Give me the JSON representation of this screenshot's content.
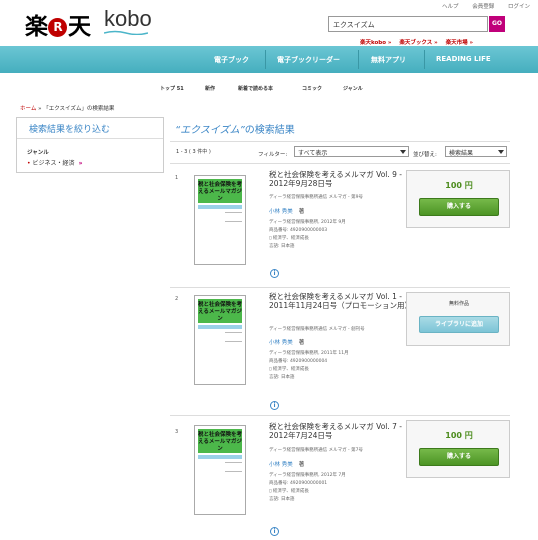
{
  "header": {
    "top_links": [
      "ヘルプ",
      "会員登録",
      "ログイン"
    ],
    "logo_left": "楽",
    "logo_r": "R",
    "logo_right": "天",
    "logo_kobo": "kobo",
    "search_value": "エクスイズム",
    "search_button": "GO",
    "sub_links": [
      "楽天kobo »",
      "楽天ブックス »",
      "楽天市場 »"
    ]
  },
  "nav": {
    "items": [
      "電子ブック",
      "電子ブックリーダー",
      "無料アプリ",
      "READING LIFE"
    ]
  },
  "categories": [
    "トップ 51",
    "新作",
    "新着で読める本",
    "コミック",
    "ジャンル"
  ],
  "breadcrumb": {
    "home": "ホーム",
    "sep": " » ",
    "current": "「エクスイズム」の検索結果"
  },
  "sidebar": {
    "title": "検索結果を絞り込む",
    "genre_label": "ジャンル",
    "genre_item": "ビジネス・経済",
    "genre_arrow": "»"
  },
  "results_header": {
    "title_italic": "“エクスイズム”",
    "title_rest": "の検索結果",
    "count": "1 - 3 ( 3 件中 )",
    "filter_label": "フィルター:",
    "filter_value": "すべて表示",
    "sort_label": "並び替え:",
    "sort_value": "検索結果"
  },
  "results": [
    {
      "num": "1",
      "cover_title": "税と社会保険を考えるメールマガジン",
      "title": "税と社会保険を考えるメルマガ Vol. 9 - 2012年9月28日号",
      "publisher": "ディーラ経営保険事務所通信 メルマガ - 第9号",
      "author": "小林 秀美",
      "author_role": "著",
      "meta": [
        "ディーラ経営保険事務所, 2012年 9月",
        "商品番号: 4920900000003",
        "経済学、経済成長",
        "言語: 日本語"
      ],
      "price": "100 円",
      "button": "購入する",
      "free": false
    },
    {
      "num": "2",
      "cover_title": "税と社会保険を考えるメールマガジン",
      "title": "税と社会保険を考えるメルマガ Vol. 1 - 2011年11月24日号（プロモーション用）",
      "publisher": "ディーラ経営保険事務所通信 メルマガ - 創刊号",
      "author": "小林 秀美",
      "author_role": "著",
      "meta": [
        "ディーラ経営保険事務所, 2011年 11月",
        "商品番号: 4920900000004",
        "経済学、経済成長",
        "言語: 日本語"
      ],
      "price": "無料作品",
      "button": "ライブラリに追加",
      "free": true
    },
    {
      "num": "3",
      "cover_title": "税と社会保険を考えるメールマガジン",
      "title": "税と社会保険を考えるメルマガ Vol. 7 - 2012年7月24日号",
      "publisher": "ディーラ経営保険事務所通信 メルマガ - 第7号",
      "author": "小林 秀美",
      "author_role": "著",
      "meta": [
        "ディーラ経営保険事務所, 2012年 7月",
        "商品番号: 4920900000001",
        "経済学、経済成長",
        "言語: 日本語"
      ],
      "price": "100 円",
      "button": "購入する",
      "free": false
    }
  ],
  "colors": {
    "brand_red": "#bf0000",
    "nav_teal": "#45aebe",
    "link_blue": "#3b86c6",
    "buy_green": "#4c9424",
    "lib_blue": "#7cc4d6",
    "go_magenta": "#c0007a"
  }
}
